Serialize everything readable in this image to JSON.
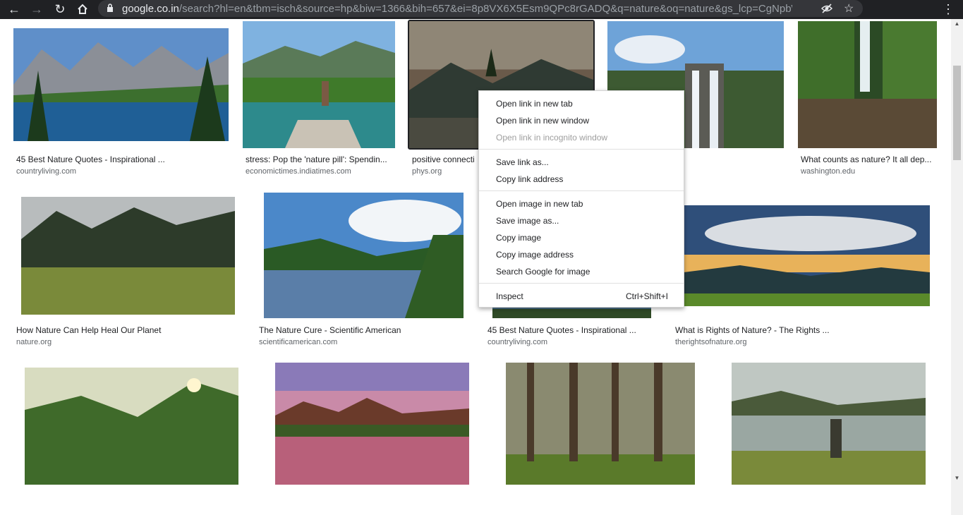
{
  "browser": {
    "url_host": "google.co.in",
    "url_rest": "/search?hl=en&tbm=isch&source=hp&biw=1366&bih=657&ei=8p8VX6X5Esm9QPc8rGADQ&q=nature&oq=nature&gs_lcp=CgNpbWcQAzIF..."
  },
  "results": [
    {
      "caption": "45 Best Nature Quotes - Inspirational ...",
      "source": "countryliving.com"
    },
    {
      "caption": "stress: Pop the 'nature pill': Spendin...",
      "source": "economictimes.indiatimes.com"
    },
    {
      "caption": "positive connecti",
      "source": "phys.org"
    },
    {
      "caption": "",
      "source": ""
    },
    {
      "caption": "What counts as nature? It all dep...",
      "source": "washington.edu"
    },
    {
      "caption": "How Nature Can Help Heal Our Planet",
      "source": "nature.org"
    },
    {
      "caption": "The Nature Cure - Scientific American",
      "source": "scientificamerican.com"
    },
    {
      "caption": "45 Best Nature Quotes - Inspirational ...",
      "source": "countryliving.com"
    },
    {
      "caption": "What is Rights of Nature? - The Rights ...",
      "source": "therightsofnature.org"
    }
  ],
  "context_menu": {
    "open_new_tab": "Open link in new tab",
    "open_new_window": "Open link in new window",
    "open_incognito": "Open link in incognito window",
    "save_link": "Save link as...",
    "copy_link": "Copy link address",
    "open_image": "Open image in new tab",
    "save_image": "Save image as...",
    "copy_image": "Copy image",
    "copy_image_address": "Copy image address",
    "search_image": "Search Google for image",
    "inspect": "Inspect",
    "inspect_shortcut": "Ctrl+Shift+I"
  }
}
